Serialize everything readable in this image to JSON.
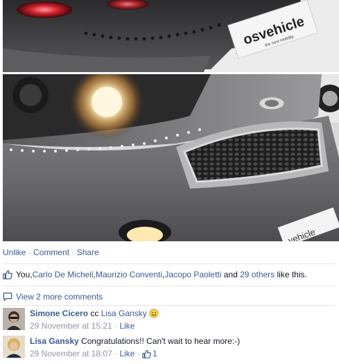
{
  "photos": {
    "top_alt": "OSV vehicle rear view with tail lights",
    "top_logo_text": "osvehicle",
    "top_logo_tagline": "the next mobility",
    "main_alt": "OSV vehicle front view with headlight on",
    "main_logo_text": "vehicle"
  },
  "actions": {
    "unlike": "Unlike",
    "comment": "Comment",
    "share": "Share",
    "separator": "·"
  },
  "likes": {
    "prefix": "You, ",
    "people": [
      "Carlo De Micheli",
      "Maurizio Conventi",
      "Jacopo Paoletti"
    ],
    "separator": ", ",
    "and_word": " and ",
    "others_link": "29 others",
    "suffix": " like this."
  },
  "view_more": {
    "label": "View 2 more comments"
  },
  "comments": [
    {
      "author": "Simone Cicero",
      "text_prefix": " cc ",
      "mention": "Lisa Gansky",
      "emoji": "smile-icon",
      "date": "29 November at 15:21",
      "separator": "·",
      "like_label": "Like",
      "like_count": ""
    },
    {
      "author": "Lisa Gansky",
      "text": " Congratulations!! Can't wait to hear more:-)",
      "date": "29 November at 18:07",
      "separator": "·",
      "like_label": "Like",
      "like_count": "1"
    }
  ],
  "colors": {
    "link": "#3b5998",
    "meta": "#9197a3",
    "text": "#141823"
  }
}
